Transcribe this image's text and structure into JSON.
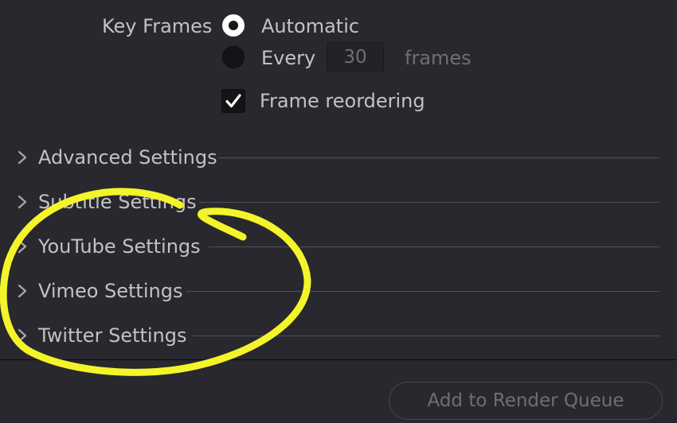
{
  "key_frames": {
    "label": "Key Frames",
    "automatic_label": "Automatic",
    "every_label": "Every",
    "every_value": "30",
    "frames_unit": "frames",
    "selected": "automatic"
  },
  "frame_reordering": {
    "label": "Frame reordering",
    "checked": true
  },
  "sections": [
    {
      "title": "Advanced Settings"
    },
    {
      "title": "Subtitle Settings"
    },
    {
      "title": "YouTube Settings"
    },
    {
      "title": "Vimeo Settings"
    },
    {
      "title": "Twitter Settings"
    }
  ],
  "footer": {
    "add_to_render_queue_label": "Add to Render Queue"
  },
  "colors": {
    "background": "#28282e",
    "text": "#c2c2c6",
    "dim_text": "#6e6e74",
    "annotation": "#f4f42a"
  }
}
